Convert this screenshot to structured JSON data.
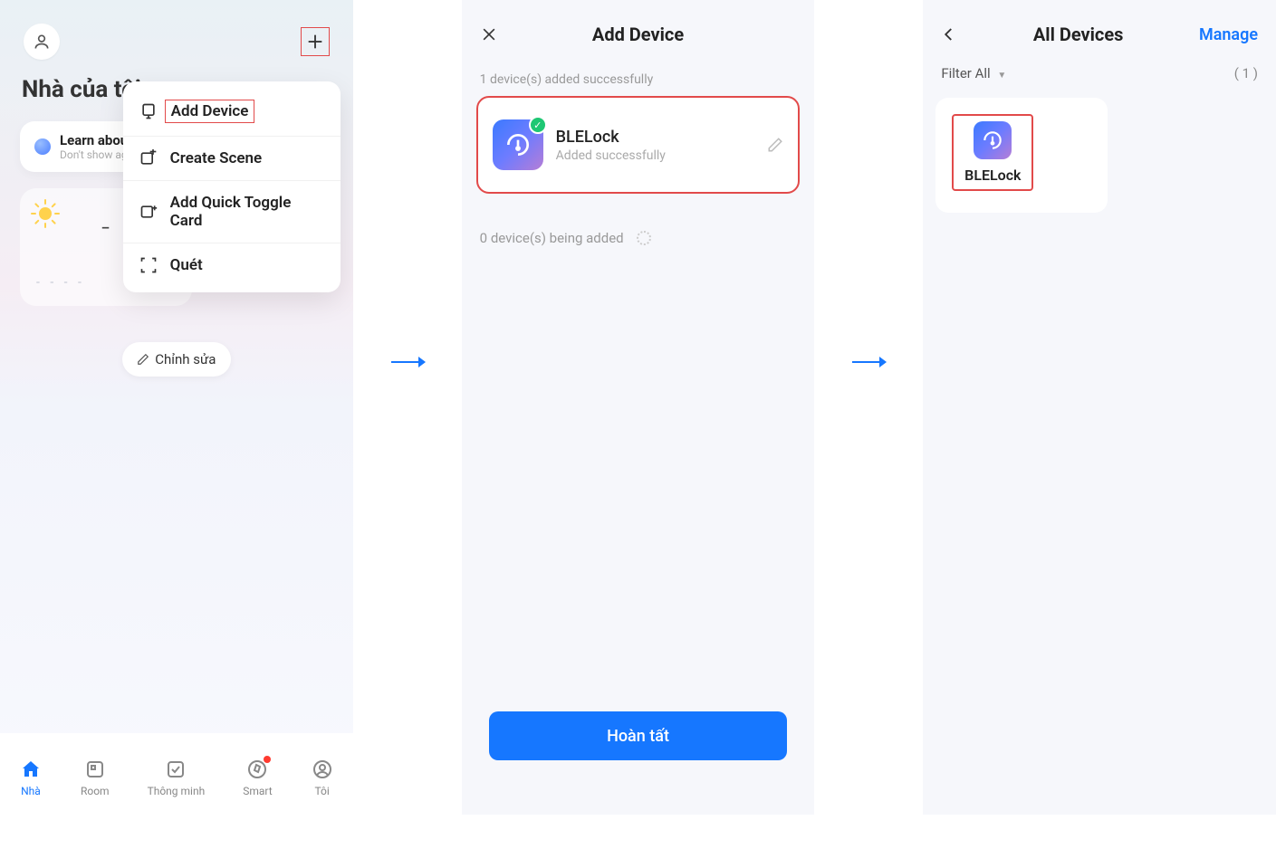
{
  "phone1": {
    "title": "Nhà của tôi …",
    "learn": {
      "title": "Learn about th",
      "sub": "Don't show again"
    },
    "weather_dashes": "- - -",
    "weather_sub": "- -   - -",
    "edit_label": "Chỉnh sửa",
    "dropdown": [
      {
        "label": "Add Device",
        "highlight": true
      },
      {
        "label": "Create Scene"
      },
      {
        "label": "Add Quick Toggle Card"
      },
      {
        "label": "Quét"
      }
    ],
    "tabs": [
      {
        "label": "Nhà",
        "active": true
      },
      {
        "label": "Room"
      },
      {
        "label": "Thông minh"
      },
      {
        "label": "Smart",
        "dot": true
      },
      {
        "label": "Tôi"
      }
    ]
  },
  "phone2": {
    "title": "Add Device",
    "added_msg": "1 device(s) added successfully",
    "device_name": "BLELock",
    "device_status": "Added successfully",
    "being_added": "0 device(s) being added",
    "done_label": "Hoàn tất"
  },
  "phone3": {
    "title": "All Devices",
    "manage": "Manage",
    "filter": "Filter All",
    "count": "( 1 )",
    "device_name": "BLELock"
  }
}
